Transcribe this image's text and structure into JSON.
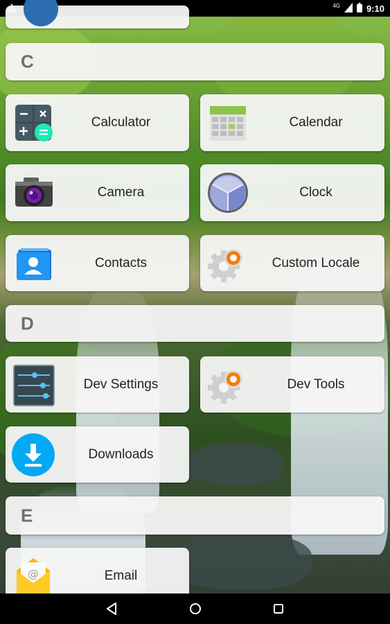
{
  "status_bar": {
    "time": "9:10",
    "network_label": "4G",
    "icons": [
      "warning-icon",
      "signal-icon",
      "battery-icon"
    ]
  },
  "sections": [
    {
      "letter": "C"
    },
    {
      "letter": "D"
    },
    {
      "letter": "E"
    }
  ],
  "apps": {
    "calculator": {
      "label": "Calculator",
      "icon": "calculator-icon"
    },
    "calendar": {
      "label": "Calendar",
      "icon": "calendar-icon"
    },
    "camera": {
      "label": "Camera",
      "icon": "camera-icon"
    },
    "clock": {
      "label": "Clock",
      "icon": "clock-icon"
    },
    "contacts": {
      "label": "Contacts",
      "icon": "contacts-icon"
    },
    "custom_locale": {
      "label": "Custom Locale",
      "icon": "gear-icon"
    },
    "dev_settings": {
      "label": "Dev Settings",
      "icon": "sliders-icon"
    },
    "dev_tools": {
      "label": "Dev Tools",
      "icon": "gear-icon"
    },
    "downloads": {
      "label": "Downloads",
      "icon": "download-icon"
    },
    "email": {
      "label": "Email",
      "icon": "email-icon"
    }
  },
  "nav_bar": {
    "buttons": [
      "back-icon",
      "home-icon",
      "recents-icon"
    ]
  },
  "colors": {
    "card_background": "#f6f6f6",
    "section_letter": "#6e6e6e",
    "label_text": "#222222",
    "status_bar": "#000000"
  }
}
